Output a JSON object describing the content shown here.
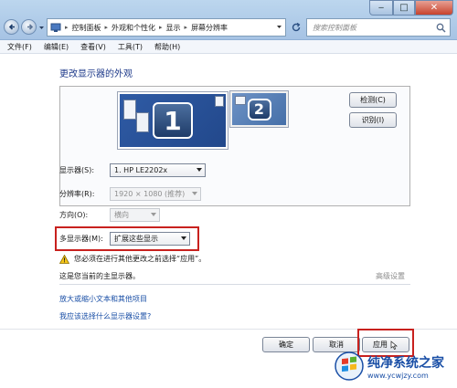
{
  "titlebar": {
    "breadcrumbs": [
      "控制面板",
      "外观和个性化",
      "显示",
      "屏幕分辨率"
    ],
    "search_placeholder": "搜索控制面板"
  },
  "menu": {
    "items": [
      "文件(F)",
      "编辑(E)",
      "查看(V)",
      "工具(T)",
      "帮助(H)"
    ]
  },
  "main": {
    "heading": "更改显示器的外观",
    "detect_label": "检测(C)",
    "identify_label": "识别(I)",
    "monitors": [
      "1",
      "2"
    ],
    "display": {
      "label": "显示器(S):",
      "value": "1. HP LE2202x"
    },
    "resolution": {
      "label": "分辨率(R):",
      "value": "1920 × 1080 (推荐)"
    },
    "orientation": {
      "label": "方向(O):",
      "value": "横向"
    },
    "multi_display": {
      "label": "多显示器(M):",
      "value": "扩展这些显示"
    },
    "warning_text": "您必须在进行其他更改之前选择“应用”。",
    "primary_note": "这是您当前的主显示器。",
    "advanced_label": "高级设置",
    "link_text_size": "放大或缩小文本和其他项目",
    "link_which_settings": "我应该选择什么显示器设置?"
  },
  "footer": {
    "ok_label": "确定",
    "cancel_label": "取消",
    "apply_label": "应用"
  },
  "watermark": {
    "title": "纯净系统之家",
    "url": "www.ycwjzy.com"
  },
  "colors": {
    "link": "#1a4fa6",
    "highlight": "#c8211e",
    "primary_monitor": "#2f5ba5",
    "secondary_monitor": "#6e93c6"
  }
}
